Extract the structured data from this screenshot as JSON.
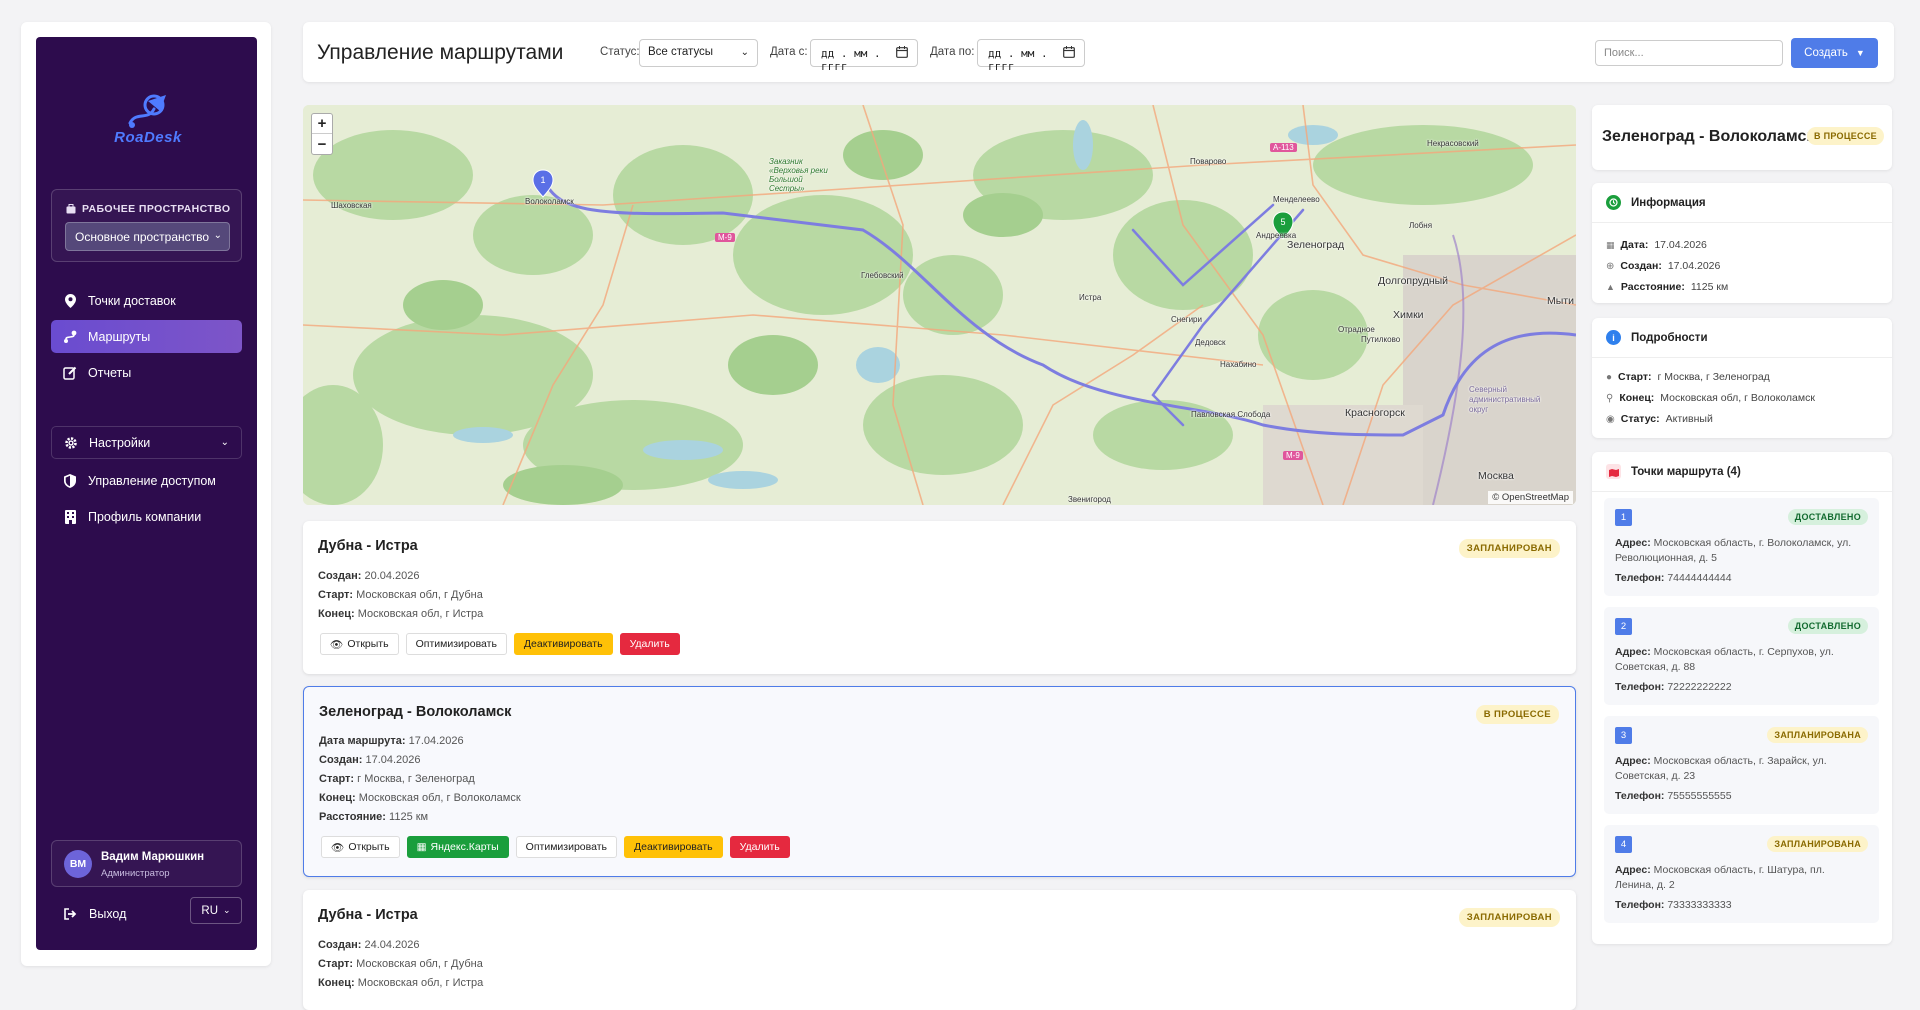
{
  "app": {
    "logo_text": "RoaDesk"
  },
  "sidebar": {
    "workspace_title": "РАБОЧЕЕ ПРОСТРАНСТВО",
    "workspace_value": "Основное пространство",
    "items": [
      {
        "label": "Точки доставок",
        "icon": "map-pin-icon"
      },
      {
        "label": "Маршруты",
        "icon": "route-icon",
        "active": true
      },
      {
        "label": "Отчеты",
        "icon": "edit-icon"
      },
      {
        "label": "Настройки",
        "icon": "gear-icon"
      },
      {
        "label": "Управление доступом",
        "icon": "shield-icon"
      },
      {
        "label": "Профиль компании",
        "icon": "building-icon"
      }
    ],
    "user": {
      "initials": "ВМ",
      "name": "Вадим Марюшкин",
      "role": "Администратор"
    },
    "logout": "Выход",
    "lang": "RU"
  },
  "header": {
    "title": "Управление маршрутами",
    "status_label": "Статус:",
    "status_value": "Все статусы",
    "date_from_label": "Дата с:",
    "date_from_value": "дд . мм . гггг",
    "date_to_label": "Дата по:",
    "date_to_value": "дд . мм . гггг",
    "search_placeholder": "Поиск...",
    "create_label": "Создать"
  },
  "map": {
    "attribution": "© OpenStreetMap",
    "zoom_in": "+",
    "zoom_out": "−",
    "markers": [
      "1",
      "5"
    ],
    "labels": [
      "Волоколамск",
      "Шаховская",
      "Поварово",
      "Менделеево",
      "Некрасовский",
      "Лобня",
      "Зеленоград",
      "Андреевка",
      "Долгопрудный",
      "Химки",
      "Мыти",
      "Глебовский",
      "Истра",
      "Снегири",
      "Дедовск",
      "Нахабино",
      "Отрадное",
      "Путилково",
      "Красногорск",
      "Павловская Слобода",
      "Москва",
      "Звенигород",
      "A-113",
      "M-9",
      "M-9",
      "Заказник «Верховья реки Большой Сестры»",
      "Северный административный округ"
    ]
  },
  "routes": [
    {
      "title": "Дубна - Истра",
      "badge": "ЗАПЛАНИРОВАН",
      "rows": [
        {
          "k": "Создан:",
          "v": "20.04.2026"
        },
        {
          "k": "Старт:",
          "v": "Московская обл, г Дубна"
        },
        {
          "k": "Конец:",
          "v": "Московская обл, г Истра"
        }
      ],
      "buttons": [
        "Открыть",
        "Оптимизировать",
        "Деактивировать",
        "Удалить"
      ]
    },
    {
      "title": "Зеленоград - Волоколамск",
      "badge": "В ПРОЦЕССЕ",
      "rows": [
        {
          "k": "Дата маршрута:",
          "v": "17.04.2026"
        },
        {
          "k": "Создан:",
          "v": "17.04.2026"
        },
        {
          "k": "Старт:",
          "v": "г Москва, г Зеленоград"
        },
        {
          "k": "Конец:",
          "v": "Московская обл, г Волоколамск"
        },
        {
          "k": "Расстояние:",
          "v": "1125 км"
        }
      ],
      "buttons": [
        "Открыть",
        "Яндекс.Карты",
        "Оптимизировать",
        "Деактивировать",
        "Удалить"
      ]
    },
    {
      "title": "Дубна - Истра",
      "badge": "ЗАПЛАНИРОВАН",
      "rows": [
        {
          "k": "Создан:",
          "v": "24.04.2026"
        },
        {
          "k": "Старт:",
          "v": "Московская обл, г Дубна"
        },
        {
          "k": "Конец:",
          "v": "Московская обл, г Истра"
        }
      ]
    }
  ],
  "detail": {
    "title": "Зеленоград - Волоколамск",
    "badge": "В ПРОЦЕССЕ",
    "info_title": "Информация",
    "info": [
      {
        "k": "Дата:",
        "v": "17.04.2026"
      },
      {
        "k": "Создан:",
        "v": "17.04.2026"
      },
      {
        "k": "Расстояние:",
        "v": "1125 км"
      }
    ],
    "details_title": "Подробности",
    "details": [
      {
        "k": "Старт:",
        "v": "г Москва, г Зеленоград"
      },
      {
        "k": "Конец:",
        "v": "Московская обл, г Волоколамск"
      },
      {
        "k": "Статус:",
        "v": "Активный"
      }
    ],
    "points_title": "Точки маршрута (4)",
    "points": [
      {
        "num": "1",
        "status": "ДОСТАВЛЕНО",
        "addr_k": "Адрес:",
        "addr": "Московская область, г. Волоколамск, ул. Революционная, д. 5",
        "phone_k": "Телефон:",
        "phone": "74444444444"
      },
      {
        "num": "2",
        "status": "ДОСТАВЛЕНО",
        "addr_k": "Адрес:",
        "addr": "Московская область, г. Серпухов, ул. Советская, д. 88",
        "phone_k": "Телефон:",
        "phone": "72222222222"
      },
      {
        "num": "3",
        "status": "ЗАПЛАНИРОВАНА",
        "addr_k": "Адрес:",
        "addr": "Московская область, г. Зарайск, ул. Советская, д. 23",
        "phone_k": "Телефон:",
        "phone": "75555555555"
      },
      {
        "num": "4",
        "status": "ЗАПЛАНИРОВАНА",
        "addr_k": "Адрес:",
        "addr": "Московская область, г. Шатура, пл. Ленина, д. 2",
        "phone_k": "Телефон:",
        "phone": "73333333333"
      }
    ]
  },
  "colors": {
    "sidebar": "#2d0c4d",
    "accent": "#4f7ce8",
    "warn": "#ffc107",
    "danger": "#e5293f",
    "success": "#1a9e3c"
  }
}
